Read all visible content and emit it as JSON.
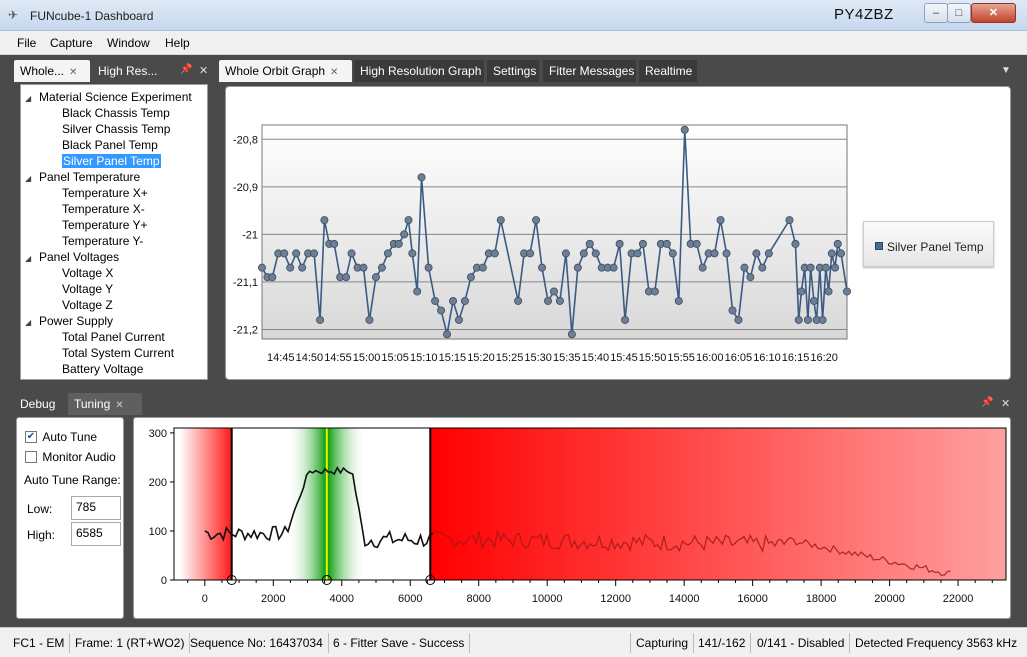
{
  "window": {
    "title": "FUNcube-1 Dashboard",
    "callsign": "PY4ZBZ",
    "min_glyph": "–",
    "max_glyph": "□",
    "close_glyph": "✕"
  },
  "menu": [
    "File",
    "Capture",
    "Window",
    "Help"
  ],
  "left_tabs": [
    {
      "label": "Whole...",
      "close": "✕"
    },
    {
      "label": "High Res...",
      "close": "✕"
    }
  ],
  "tree": [
    {
      "label": "Material Science Experiment",
      "level": 0,
      "expanded": true
    },
    {
      "label": "Black Chassis Temp",
      "level": 1
    },
    {
      "label": "Silver Chassis Temp",
      "level": 1
    },
    {
      "label": "Black Panel Temp",
      "level": 1
    },
    {
      "label": "Silver Panel Temp",
      "level": 1,
      "selected": true
    },
    {
      "label": "Panel Temperature",
      "level": 0,
      "expanded": true
    },
    {
      "label": "Temperature X+",
      "level": 1
    },
    {
      "label": "Temperature X-",
      "level": 1
    },
    {
      "label": "Temperature Y+",
      "level": 1
    },
    {
      "label": "Temperature Y-",
      "level": 1
    },
    {
      "label": "Panel Voltages",
      "level": 0,
      "expanded": true
    },
    {
      "label": "Voltage X",
      "level": 1
    },
    {
      "label": "Voltage Y",
      "level": 1
    },
    {
      "label": "Voltage Z",
      "level": 1
    },
    {
      "label": "Power Supply",
      "level": 0,
      "expanded": true
    },
    {
      "label": "Total Panel Current",
      "level": 1
    },
    {
      "label": "Total System Current",
      "level": 1
    },
    {
      "label": "Battery Voltage",
      "level": 1
    }
  ],
  "doc_tabs": [
    {
      "label": "Whole Orbit Graph",
      "close": "✕",
      "active": true
    },
    {
      "label": "High Resolution Graph"
    },
    {
      "label": "Settings"
    },
    {
      "label": "Fitter Messages"
    },
    {
      "label": "Realtime"
    }
  ],
  "chart_data": {
    "type": "line",
    "series": [
      {
        "name": "Silver Panel Temp",
        "color": "#3b5b82",
        "values": [
          -21.07,
          -21.09,
          -21.09,
          -21.04,
          -21.04,
          -21.07,
          -21.04,
          -21.07,
          -21.04,
          -21.04,
          -21.18,
          -20.97,
          -21.02,
          -21.02,
          -21.09,
          -21.09,
          -21.04,
          -21.07,
          -21.07,
          -21.18,
          -21.09,
          -21.07,
          -21.04,
          -21.02,
          -21.02,
          -21.0,
          -20.97,
          -21.04,
          -21.12,
          -20.88,
          -21.07,
          -21.14,
          -21.16,
          -21.21,
          -21.14,
          -21.18,
          -21.14,
          -21.09,
          -21.07,
          -21.07,
          -21.04,
          -21.04,
          -20.97,
          -21.14,
          -21.04,
          -21.04,
          -20.97,
          -21.07,
          -21.14,
          -21.12,
          -21.14,
          -21.04,
          -21.21,
          -21.07,
          -21.04,
          -21.02,
          -21.04,
          -21.07,
          -21.07,
          -21.07,
          -21.02,
          -21.18,
          -21.04,
          -21.04,
          -21.02,
          -21.12,
          -21.12,
          -21.02,
          -21.02,
          -21.04,
          -21.14,
          -20.78,
          -21.02,
          -21.02,
          -21.07,
          -21.04,
          -21.04,
          -20.97,
          -21.04,
          -21.16,
          -21.18,
          -21.07,
          -21.09,
          -21.04,
          -21.07,
          -21.04,
          -20.97,
          -21.02,
          -21.18,
          -21.12,
          -21.07,
          -21.18,
          -21.07,
          -21.14,
          -21.18,
          -21.07,
          -21.18,
          -21.07,
          -21.12,
          -21.04,
          -21.07,
          -21.02,
          -21.04,
          -21.12
        ],
        "x_fraction": [
          0.0,
          0.01,
          0.019,
          0.03,
          0.041,
          0.052,
          0.063,
          0.074,
          0.085,
          0.096,
          0.107,
          0.115,
          0.124,
          0.133,
          0.144,
          0.155,
          0.165,
          0.176,
          0.187,
          0.198,
          0.21,
          0.221,
          0.232,
          0.243,
          0.252,
          0.262,
          0.27,
          0.277,
          0.286,
          0.294,
          0.307,
          0.319,
          0.33,
          0.341,
          0.352,
          0.363,
          0.374,
          0.385,
          0.396,
          0.407,
          0.418,
          0.429,
          0.44,
          0.472,
          0.483,
          0.494,
          0.505,
          0.516,
          0.527,
          0.538,
          0.549,
          0.56,
          0.571,
          0.582,
          0.593,
          0.604,
          0.615,
          0.626,
          0.637,
          0.648,
          0.659,
          0.669,
          0.681,
          0.692,
          0.702,
          0.713,
          0.724,
          0.735,
          0.746,
          0.757,
          0.768,
          0.779,
          0.79,
          0.801,
          0.812,
          0.823,
          0.834,
          0.845,
          0.856,
          0.867,
          0.878,
          0.889,
          0.9,
          0.911,
          0.922,
          0.934,
          0.972,
          0.983,
          0.989,
          0.994,
          1.0,
          1.006,
          1.011,
          1.017,
          1.022,
          1.028,
          1.033,
          1.039,
          1.044,
          1.05,
          1.056,
          1.061,
          1.067,
          1.078
        ]
      }
    ],
    "ylim": [
      -21.22,
      -20.77
    ],
    "yticks": [
      "-20,8",
      "-20,9",
      "-21",
      "-21,1",
      "-21,2"
    ],
    "ytick_values": [
      -20.8,
      -20.9,
      -21.0,
      -21.1,
      -21.2
    ],
    "xtick_labels": [
      "14:45",
      "14:50",
      "14:55",
      "15:00",
      "15:05",
      "15:10",
      "15:15",
      "15:20",
      "15:25",
      "15:30",
      "15:35",
      "15:40",
      "15:45",
      "15:50",
      "15:55",
      "16:00",
      "16:05",
      "16:10",
      "16:15",
      "16:20"
    ],
    "legend": "right"
  },
  "bottom_tabs": [
    {
      "label": "Debug"
    },
    {
      "label": "Tuning",
      "close": "✕",
      "active": true
    }
  ],
  "tuning": {
    "auto_tune_label": "Auto Tune",
    "auto_tune_checked": "✔",
    "monitor_audio_label": "Monitor Audio",
    "range_label": "Auto Tune Range:",
    "low_label": "Low:",
    "low_value": "785",
    "high_label": "High:",
    "high_value": "6585"
  },
  "spectrum": {
    "yticks": [
      "300",
      "200",
      "100",
      "0"
    ],
    "ytick_values": [
      300,
      200,
      100,
      0
    ],
    "xticks": [
      "0",
      "2000",
      "4000",
      "6000",
      "8000",
      "10000",
      "12000",
      "14000",
      "16000",
      "18000",
      "20000",
      "22000"
    ],
    "xtick_values": [
      0,
      2000,
      4000,
      6000,
      8000,
      10000,
      12000,
      14000,
      16000,
      18000,
      20000,
      22000
    ],
    "xlim": [
      -900,
      23400
    ],
    "ylim": [
      0,
      310
    ],
    "low": 785,
    "high": 6585,
    "signal": 3563
  },
  "status": [
    "FC1 - EM",
    "Frame: 1 (RT+WO2)",
    "Sequence No: 16437034",
    "6 - Fitter Save - Success",
    "Capturing",
    "141/-162",
    "0/141 - Disabled",
    "Detected Frequency  3563 kHz"
  ]
}
